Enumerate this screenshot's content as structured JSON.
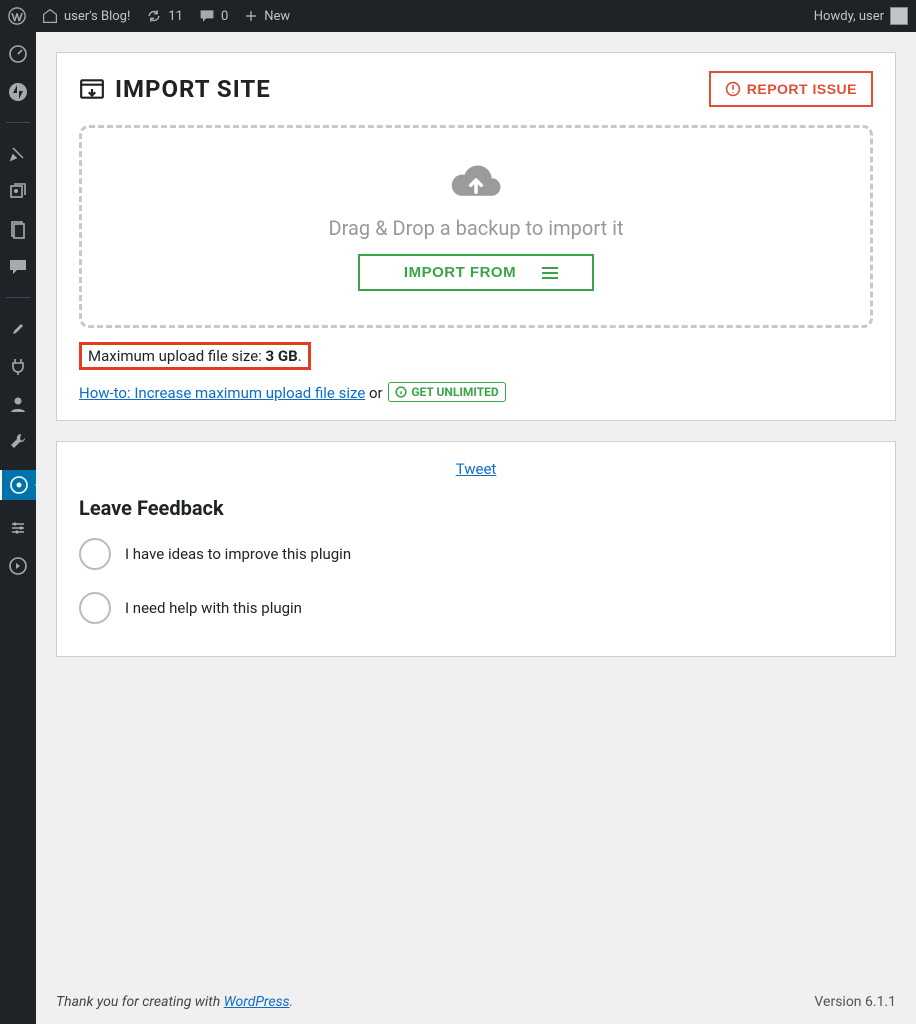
{
  "adminbar": {
    "site_name": "user's Blog!",
    "refresh_count": "11",
    "comments_count": "0",
    "new_label": "New",
    "howdy": "Howdy, user"
  },
  "page": {
    "title": "IMPORT SITE",
    "report_issue": "REPORT ISSUE",
    "drop_text": "Drag & Drop a backup to import it",
    "import_from": "IMPORT FROM",
    "max_upload_prefix": "Maximum upload file size: ",
    "max_upload_value": "3 GB",
    "max_upload_suffix": ".",
    "howto_link": "How-to: Increase maximum upload file size",
    "or": " or ",
    "get_unlimited": "GET UNLIMITED"
  },
  "feedback": {
    "tweet": "Tweet",
    "heading": "Leave Feedback",
    "option_ideas": "I have ideas to improve this plugin",
    "option_help": "I need help with this plugin"
  },
  "footer": {
    "thank_prefix": "Thank you for creating with ",
    "wordpress": "WordPress",
    "thank_suffix": ".",
    "version": "Version 6.1.1"
  }
}
